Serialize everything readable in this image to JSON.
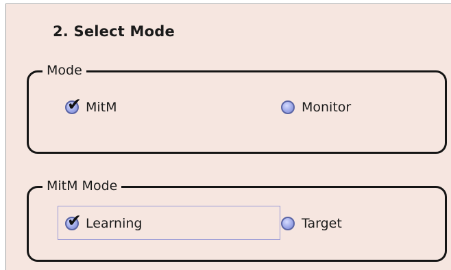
{
  "section": {
    "title": "2. Select Mode"
  },
  "mode_group": {
    "legend": "Mode",
    "options": [
      {
        "label": "MitM",
        "selected": true
      },
      {
        "label": "Monitor",
        "selected": false
      }
    ]
  },
  "mitm_mode_group": {
    "legend": "MitM Mode",
    "options": [
      {
        "label": "Learning",
        "selected": true
      },
      {
        "label": "Target",
        "selected": false
      }
    ]
  },
  "icons": {
    "check": "✔"
  },
  "colors": {
    "panel_bg": "#f6e6e0",
    "radio_fill": "#9aa5e6",
    "radio_border": "#5a64a4"
  }
}
